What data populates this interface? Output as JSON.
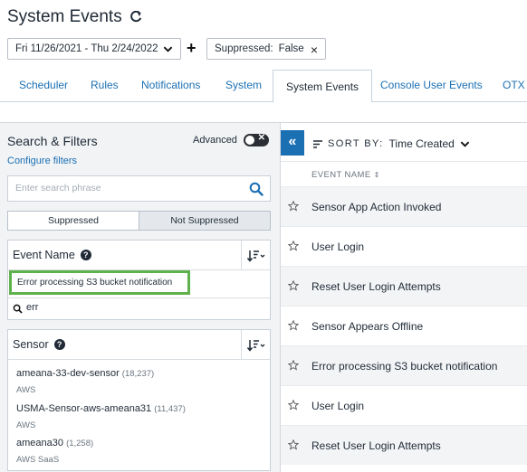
{
  "header": {
    "title": "System Events",
    "date_range": "Fri 11/26/2021 - Thu 2/24/2022",
    "add_filter": "+",
    "chip_label": "Suppressed:",
    "chip_value": "False",
    "chip_close": "×"
  },
  "tabs": [
    {
      "label": "Scheduler"
    },
    {
      "label": "Rules"
    },
    {
      "label": "Notifications"
    },
    {
      "label": "System"
    },
    {
      "label": "System Events",
      "active": true
    },
    {
      "label": "Console User Events"
    },
    {
      "label": "OTX"
    }
  ],
  "filters": {
    "title": "Search & Filters",
    "advanced_label": "Advanced",
    "configure_link": "Configure filters",
    "search_placeholder": "Enter search phrase",
    "segment": [
      "Suppressed",
      "Not Suppressed"
    ],
    "event_name_panel": {
      "title": "Event Name",
      "selected_item": "Error processing S3 bucket notification",
      "filter_value": "err"
    },
    "sensor_panel": {
      "title": "Sensor",
      "items": [
        {
          "name": "ameana-33-dev-sensor",
          "count": "(18,237)",
          "sub": "AWS"
        },
        {
          "name": "USMA-Sensor-aws-ameana31",
          "count": "(11,437)",
          "sub": "AWS"
        },
        {
          "name": "ameana30",
          "count": "(1,258)",
          "sub": "AWS SaaS"
        }
      ]
    }
  },
  "results": {
    "collapse_label": "«",
    "sort_by_label": "SORT BY:",
    "sort_by_value": "Time Created",
    "column_header": "EVENT NAME",
    "rows": [
      {
        "name": "Sensor App Action Invoked"
      },
      {
        "name": "User Login"
      },
      {
        "name": "Reset User Login Attempts"
      },
      {
        "name": "Sensor Appears Offline"
      },
      {
        "name": "Error processing S3 bucket notification"
      },
      {
        "name": "User Login"
      },
      {
        "name": "Reset User Login Attempts"
      }
    ]
  },
  "colors": {
    "accent": "#1b6fb3",
    "highlight_border": "#5eb14b",
    "panel_bg": "#f1f3f5"
  }
}
